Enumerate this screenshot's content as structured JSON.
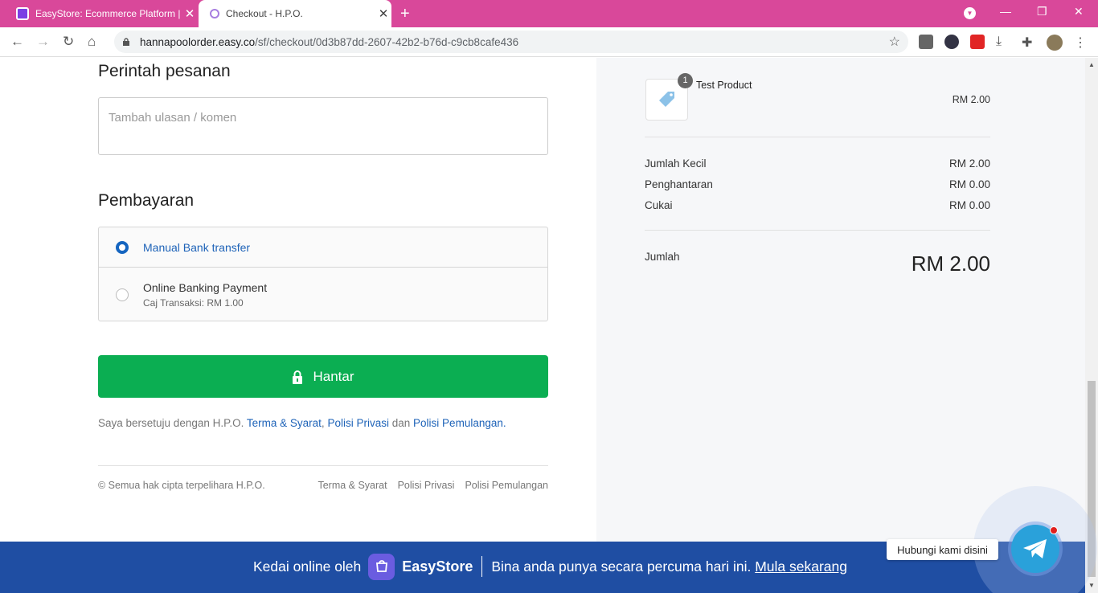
{
  "browser": {
    "tabs": [
      {
        "title": "EasyStore: Ecommerce Platform |"
      },
      {
        "title": "Checkout - H.P.O."
      }
    ],
    "url_host": "hannapoolorder.easy.co",
    "url_path": "/sf/checkout/0d3b87dd-2607-42b2-b76d-c9cb8cafe436"
  },
  "order_note": {
    "heading": "Perintah pesanan",
    "placeholder": "Tambah ulasan / komen"
  },
  "payment": {
    "heading": "Pembayaran",
    "options": [
      {
        "label": "Manual Bank transfer",
        "selected": true
      },
      {
        "label": "Online Banking Payment",
        "sub": "Caj Transaksi: RM 1.00",
        "selected": false
      }
    ]
  },
  "submit_label": "Hantar",
  "agreement": {
    "prefix": "Saya bersetuju dengan H.P.O.",
    "terms": "Terma & Syarat",
    "comma": ",",
    "privacy": "Polisi Privasi",
    "and": "dan",
    "refund": "Polisi Pemulangan",
    "period": "."
  },
  "footer": {
    "copyright": "© Semua hak cipta terpelihara H.P.O.",
    "links": [
      "Terma & Syarat",
      "Polisi Privasi",
      "Polisi Pemulangan"
    ]
  },
  "summary": {
    "product": {
      "name": "Test Product",
      "qty": "1",
      "price": "RM 2.00"
    },
    "rows": [
      {
        "label": "Jumlah Kecil",
        "value": "RM 2.00"
      },
      {
        "label": "Penghantaran",
        "value": "RM 0.00"
      },
      {
        "label": "Cukai",
        "value": "RM 0.00"
      }
    ],
    "total_label": "Jumlah",
    "total_value": "RM 2.00"
  },
  "banner": {
    "prefix": "Kedai online oleh",
    "brand": "EasyStore",
    "text": "Bina anda punya secara percuma hari ini.",
    "cta": "Mula sekarang"
  },
  "contact": {
    "label": "Hubungi kami disini"
  },
  "colors": {
    "tabbar": "#d9489a",
    "submit": "#0bae52",
    "banner": "#1f4ea3",
    "link": "#1e63b8"
  }
}
